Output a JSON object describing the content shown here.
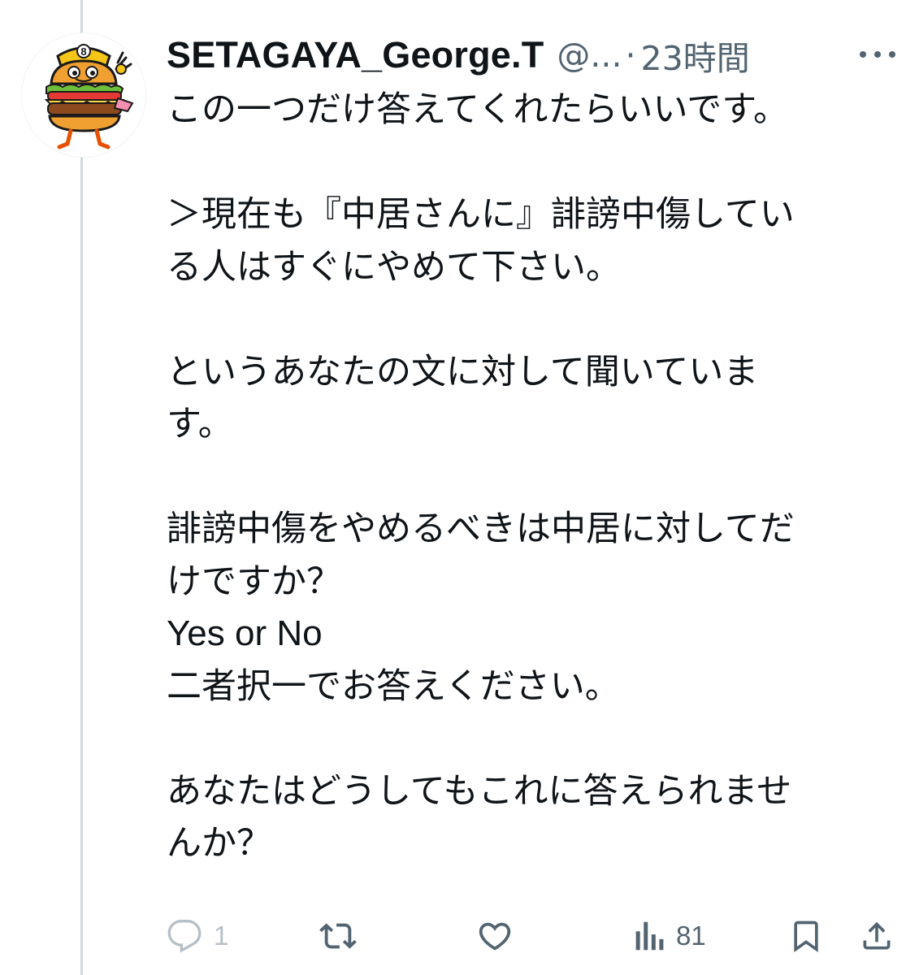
{
  "tweet": {
    "display_name": "SETAGAYA_George.T",
    "handle": "@...",
    "separator": "·",
    "time": "23時間",
    "avatar_icon": "hamburger-mascot-avatar",
    "avatar_badge": "8",
    "paragraphs": [
      [
        "この一つだけ答えてくれたらいいです。"
      ],
      [
        "＞現在も『中居さんに』誹謗中傷してい",
        "る人はすぐにやめて下さい。"
      ],
      [
        "というあなたの文に対して聞いていま",
        "す。"
      ],
      [
        "誹謗中傷をやめるべきは中居に対してだ",
        "けですか？",
        "Yes or No",
        "二者択一でお答えください。"
      ],
      [
        "あなたはどうしてもこれに答えられませ",
        "んか？"
      ]
    ]
  },
  "actions": {
    "reply": {
      "icon": "reply-icon",
      "count": "1"
    },
    "retweet": {
      "icon": "retweet-icon",
      "count": ""
    },
    "like": {
      "icon": "heart-icon",
      "count": ""
    },
    "views": {
      "icon": "views-icon",
      "count": "81"
    },
    "bookmark": {
      "icon": "bookmark-icon",
      "count": ""
    },
    "share": {
      "icon": "share-icon",
      "count": ""
    }
  },
  "colors": {
    "text_primary": "#0f1419",
    "text_secondary": "#536471",
    "thread_line": "#cfd9de",
    "reply_faded": "#b6c0c7"
  }
}
